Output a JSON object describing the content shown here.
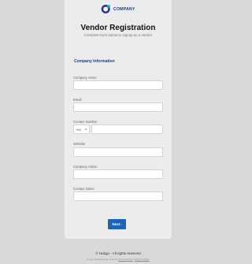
{
  "header": {
    "logo_text": "COMPANY",
    "title": "Vendor Registration",
    "subtitle": "Complete form below to signup as a vendor"
  },
  "section": {
    "title": "Company Information"
  },
  "fields": {
    "company_name": {
      "label": "Company name",
      "value": "",
      "placeholder": ""
    },
    "email": {
      "label": "Email",
      "value": "",
      "placeholder": ""
    },
    "contact_number": {
      "label": "Contact Number",
      "country_code": "+63",
      "value": "",
      "placeholder": ""
    },
    "website": {
      "label": "Website",
      "value": "",
      "placeholder": ""
    },
    "company_admin": {
      "label": "Company Admin",
      "value": "",
      "placeholder": ""
    },
    "contact_name": {
      "label": "Contact Name",
      "value": "",
      "placeholder": ""
    }
  },
  "actions": {
    "next_label": "Next",
    "next_arrow": "›"
  },
  "footer": {
    "copyright": "© Hubgo - All rights reserved",
    "legal_prefix": "If you need any help, visit our",
    "terms_label": "Terms Of Use",
    "privacy_label": "Privacy Policy"
  },
  "colors": {
    "accent": "#1f63b6",
    "logo": "#1f3c88",
    "card_bg": "#ececec",
    "page_bg": "#d9d9d9"
  },
  "icons": {
    "logo": "company-logo-icon",
    "dropdown": "chevron-down-icon"
  }
}
